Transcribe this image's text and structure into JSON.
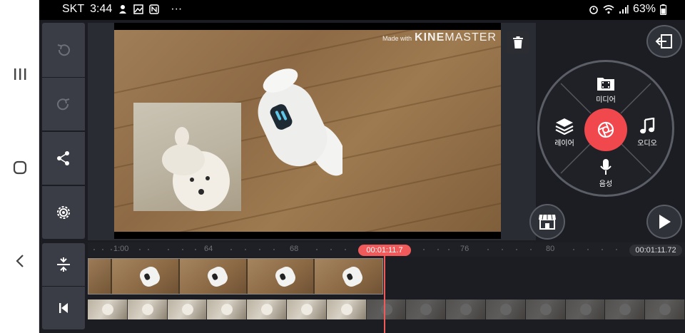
{
  "status_bar": {
    "carrier": "SKT",
    "time": "3:44",
    "more": "···",
    "battery": "63%"
  },
  "watermark": {
    "made_with": "Made with",
    "brand_bold": "KINE",
    "brand_light": "MASTER"
  },
  "media_wheel": {
    "media_label": "미디어",
    "layer_label": "레이어",
    "audio_label": "오디오",
    "voice_label": "음성"
  },
  "timeline": {
    "ruler_labels": [
      "1:00",
      "64",
      "68",
      "76",
      "80"
    ],
    "current_time": "00:01:11.7",
    "total_time": "00:01:11.72"
  },
  "colors": {
    "accent": "#f05a5a",
    "record": "#f0484d",
    "panel": "#3a3d45"
  }
}
